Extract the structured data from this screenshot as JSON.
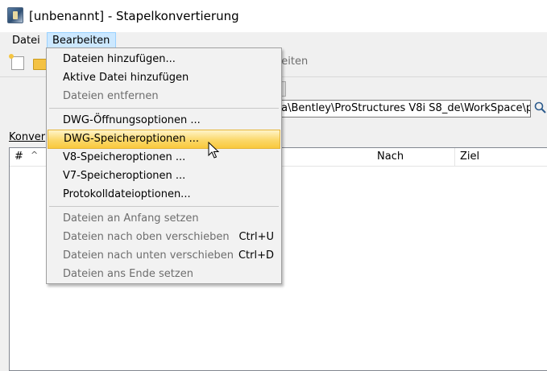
{
  "window": {
    "title": "[unbenannt] - Stapelkonvertierung"
  },
  "menubar": {
    "items": [
      {
        "label": "Datei"
      },
      {
        "label": "Bearbeiten"
      }
    ]
  },
  "toolbar": {
    "label_fragment": "beiten"
  },
  "path": {
    "value": "ta\\Bentley\\ProStructures V8i S8_de\\WorkSpace\\p"
  },
  "panel": {
    "label_fragment": "Konver"
  },
  "table": {
    "columns": [
      "#",
      "Nach",
      "Ziel"
    ]
  },
  "menu": {
    "items": [
      {
        "label": "Dateien hinzufügen...",
        "enabled": true
      },
      {
        "label": "Aktive Datei hinzufügen",
        "enabled": true
      },
      {
        "label": "Dateien entfernen",
        "enabled": false
      },
      {
        "label": "DWG-Öffnungsoptionen ...",
        "enabled": true
      },
      {
        "label": "DWG-Speicheroptionen ...",
        "enabled": true,
        "highlighted": true
      },
      {
        "label": "V8-Speicheroptionen ...",
        "enabled": true
      },
      {
        "label": "V7-Speicheroptionen ...",
        "enabled": true
      },
      {
        "label": "Protokolldateioptionen...",
        "enabled": true
      },
      {
        "label": "Dateien an Anfang setzen",
        "enabled": false
      },
      {
        "label": "Dateien nach oben verschieben",
        "shortcut": "Ctrl+U",
        "enabled": false
      },
      {
        "label": "Dateien nach unten verschieben",
        "shortcut": "Ctrl+D",
        "enabled": false
      },
      {
        "label": "Dateien ans Ende setzen",
        "enabled": false
      }
    ]
  },
  "colors": {
    "highlight": "#f9c93d",
    "disabled_text": "#6d6d6d",
    "menu_active": "#cce8ff"
  }
}
